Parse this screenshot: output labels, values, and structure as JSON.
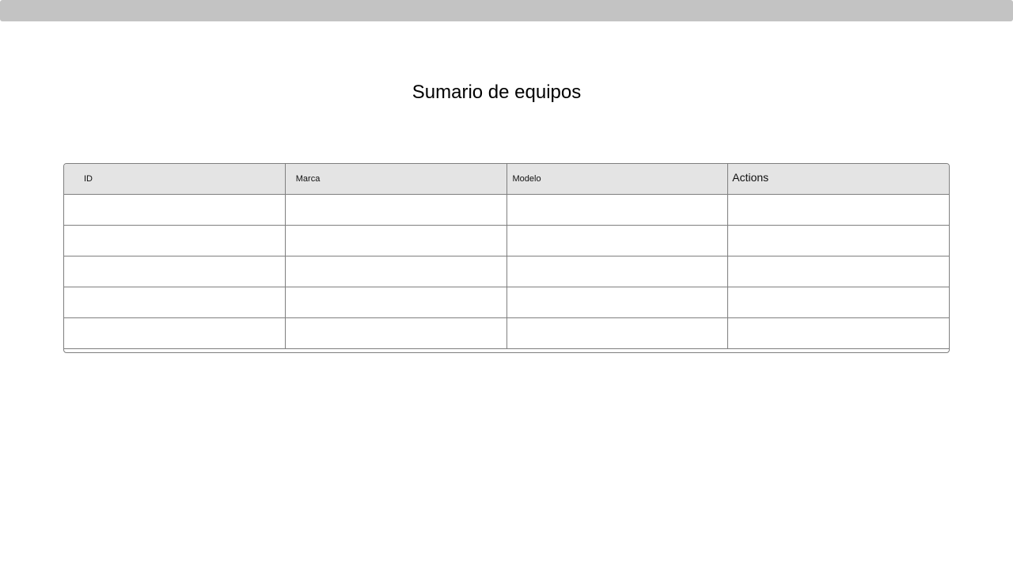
{
  "page": {
    "title": "Sumario de equipos"
  },
  "table": {
    "headers": [
      "ID",
      "Marca",
      "Modelo",
      "Actions"
    ],
    "rows": [
      [
        "",
        "",
        "",
        ""
      ],
      [
        "",
        "",
        "",
        ""
      ],
      [
        "",
        "",
        "",
        ""
      ],
      [
        "",
        "",
        "",
        ""
      ],
      [
        "",
        "",
        "",
        ""
      ]
    ]
  },
  "colors": {
    "top_bar": "#c3c3c3",
    "header_bg": "#e4e4e4",
    "border": "#7f7f7f"
  }
}
